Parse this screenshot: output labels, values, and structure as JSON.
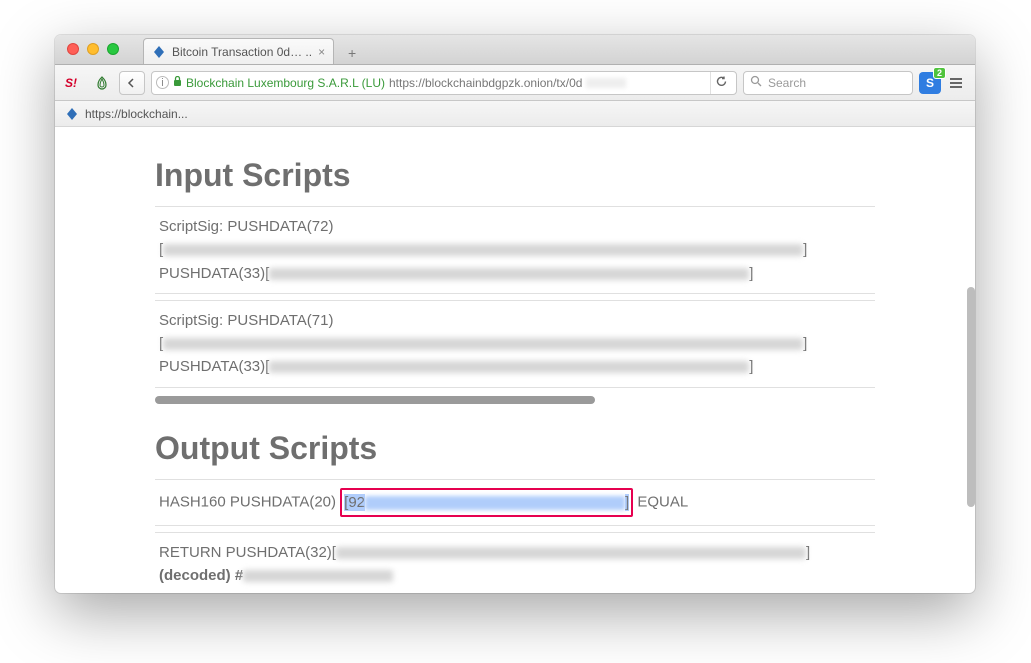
{
  "tab": {
    "title": "Bitcoin Transaction 0d… ..",
    "close": "×"
  },
  "newtab_label": "+",
  "toolbar": {
    "ev_label": "Blockchain Luxembourg S.A.R.L (LU)",
    "url": "https://blockchainbdgpzk.onion/tx/0d",
    "search_placeholder": "Search",
    "ext_s": "S",
    "ext_badge": "2"
  },
  "bookmark": {
    "label": "https://blockchain..."
  },
  "content": {
    "input_heading": "Input Scripts",
    "output_heading": "Output Scripts",
    "sig1_line1": "ScriptSig: PUSHDATA(72)",
    "sig1_line2_open": "[",
    "sig1_line2_close": "]",
    "sig1_line3_a": "PUSHDATA(33)[",
    "sig1_line3_b": "]",
    "sig2_line1": "ScriptSig: PUSHDATA(71)",
    "sig2_line2_open": "[",
    "sig2_line2_close": "]",
    "sig2_line3_a": "PUSHDATA(33)[",
    "sig2_line3_b": "]",
    "out1_a": "HASH160 PUSHDATA(20)",
    "out1_92": "[92",
    "out1_close": "]",
    "out1_equal": " EQUAL",
    "out2_a": "RETURN PUSHDATA(32)[",
    "out2_b": "]",
    "out2_decoded": "(decoded) #"
  }
}
